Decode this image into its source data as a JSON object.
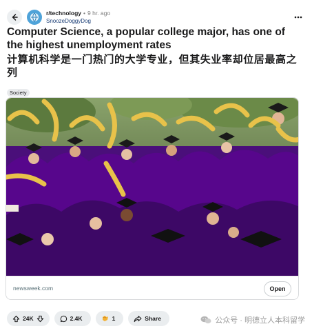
{
  "post": {
    "subreddit": "r/technology",
    "separator": "•",
    "time_ago": "9 hr. ago",
    "author": "SnoozeDoggyDog",
    "title": "Computer Science, a popular college major, has one of the highest unemployment rates",
    "title_translation": "计算机科学是一门热门的大学专业，但其失业率却位居最高之列",
    "flair": "Society"
  },
  "link_card": {
    "domain": "newsweek.com",
    "open_label": "Open"
  },
  "actions": {
    "upvotes": "24K",
    "comments": "2.4K",
    "awards": "1",
    "share_label": "Share"
  },
  "watermark": {
    "text": "公众号 · 明德立人本科留学"
  },
  "icons": {
    "back": "back-arrow-icon",
    "more": "more-options-icon",
    "upvote": "upvote-icon",
    "downvote": "downvote-icon",
    "comment": "comment-icon",
    "award": "award-icon",
    "share": "share-icon",
    "wechat": "wechat-icon"
  },
  "colors": {
    "gown_purple": "#57068c",
    "balloon_yellow": "#e8c24a",
    "pill_bg": "#eaedef",
    "username_blue": "#1c3f77"
  }
}
